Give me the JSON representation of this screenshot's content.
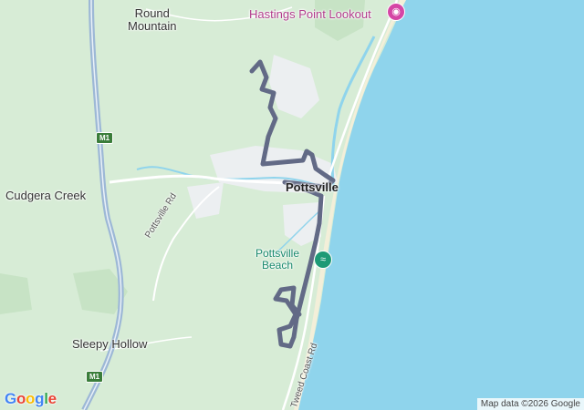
{
  "map": {
    "colors": {
      "land": "#d7ecd6",
      "ocean": "#8fd4ec",
      "beach": "#f3efd9",
      "urban": "#eceff1",
      "route": "#626a86",
      "highway": "#9db8d6",
      "water_channel": "#8fd4ec",
      "poi_lookout": "#d546a5",
      "poi_beach": "#1d9a76"
    },
    "places": [
      {
        "id": "round-mountain",
        "name": "Round\nMountain"
      },
      {
        "id": "cudgera-creek",
        "name": "Cudgera Creek"
      },
      {
        "id": "pottsville",
        "name": "Pottsville"
      },
      {
        "id": "sleepy-hollow",
        "name": "Sleepy Hollow"
      }
    ],
    "pois": [
      {
        "id": "hastings-point-lookout",
        "name": "Hastings Point Lookout",
        "icon": "camera-icon"
      },
      {
        "id": "pottsville-beach",
        "name": "Pottsville\nBeach",
        "icon": "swimming-icon"
      }
    ],
    "roads": [
      {
        "id": "pottsville-rd",
        "name": "Pottsville Rd"
      },
      {
        "id": "tweed-coast-rd",
        "name": "Tweed Coast Rd"
      }
    ],
    "shields": [
      {
        "id": "m1-north",
        "label": "M1"
      },
      {
        "id": "m1-south",
        "label": "M1"
      }
    ],
    "logo": "Google",
    "attribution": "Map data ©2026 Google"
  }
}
